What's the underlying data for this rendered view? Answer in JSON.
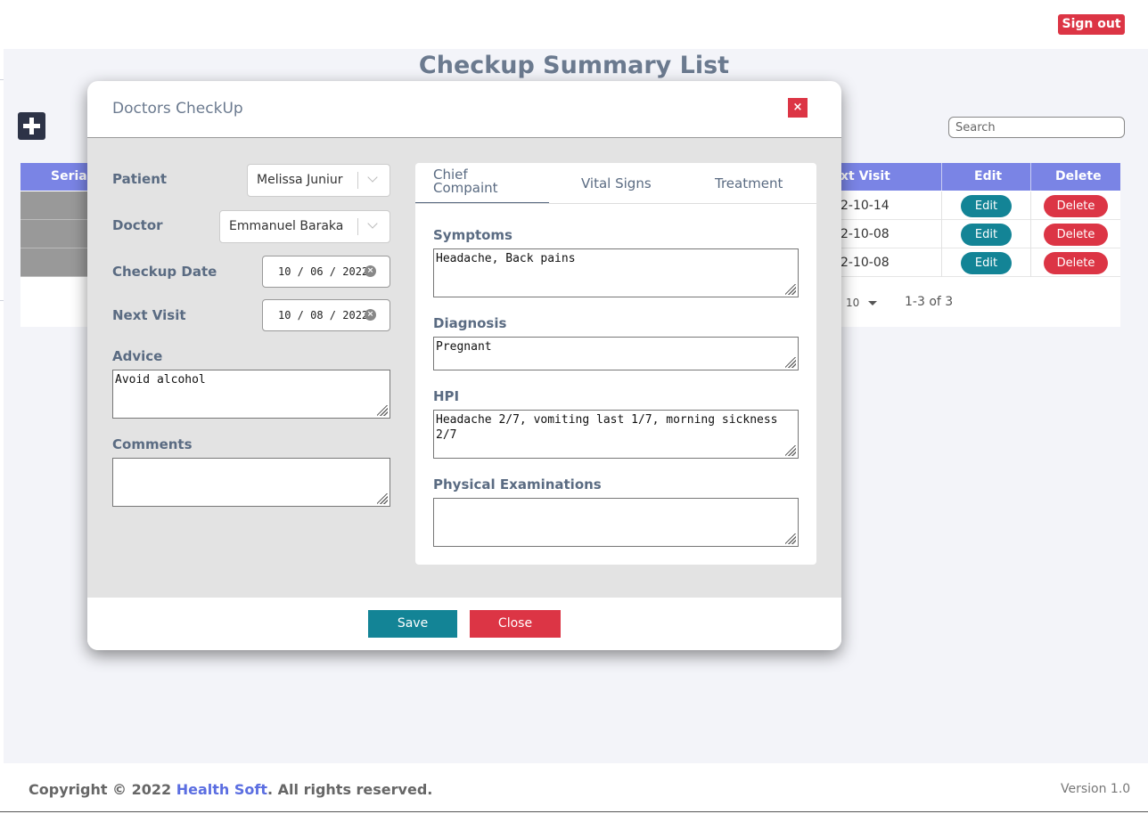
{
  "header": {
    "signout_label": "Sign out"
  },
  "page": {
    "title": "Checkup Summary List",
    "search_placeholder": "Search"
  },
  "table": {
    "columns": {
      "serial": "Serial",
      "next_visit": "xt Visit",
      "edit": "Edit",
      "delete": "Delete"
    },
    "rows": [
      {
        "next_visit": "2-10-14",
        "edit": "Edit",
        "delete": "Delete"
      },
      {
        "next_visit": "2-10-08",
        "edit": "Edit",
        "delete": "Delete"
      },
      {
        "next_visit": "2-10-08",
        "edit": "Edit",
        "delete": "Delete"
      }
    ],
    "rows_per_page": "10",
    "range_text": "1-3 of 3"
  },
  "modal": {
    "title": "Doctors CheckUp",
    "close_x": "×",
    "patient": {
      "label": "Patient",
      "value": "Melissa Juniur"
    },
    "doctor": {
      "label": "Doctor",
      "value": "Emmanuel Baraka"
    },
    "checkup_date": {
      "label": "Checkup Date",
      "value": "10 / 06 / 2022"
    },
    "next_visit": {
      "label": "Next Visit",
      "value": "10 / 08 / 2022"
    },
    "advice": {
      "label": "Advice",
      "value": "Avoid alcohol"
    },
    "comments": {
      "label": "Comments",
      "value": ""
    },
    "tabs": [
      {
        "label": "Chief Compaint",
        "active": true
      },
      {
        "label": "Vital Signs",
        "active": false
      },
      {
        "label": "Treatment",
        "active": false
      }
    ],
    "symptoms": {
      "label": "Symptoms",
      "value": "Headache, Back pains"
    },
    "diagnosis": {
      "label": "Diagnosis",
      "value": "Pregnant"
    },
    "hpi": {
      "label": "HPI",
      "value": "Headache 2/7, vomiting last 1/7, morning sickness 2/7"
    },
    "physical": {
      "label": "Physical Examinations",
      "value": ""
    },
    "save_label": "Save",
    "close_label": "Close"
  },
  "footer": {
    "copyright_prefix": "Copyright © 2022 ",
    "brand": "Health Soft",
    "copyright_suffix": ". All rights reserved.",
    "version": "Version 1.0"
  },
  "colors": {
    "header_blue": "#7a84e5",
    "danger_red": "#dc3545",
    "teal": "#138496",
    "brand_link": "#5b6ee1"
  }
}
